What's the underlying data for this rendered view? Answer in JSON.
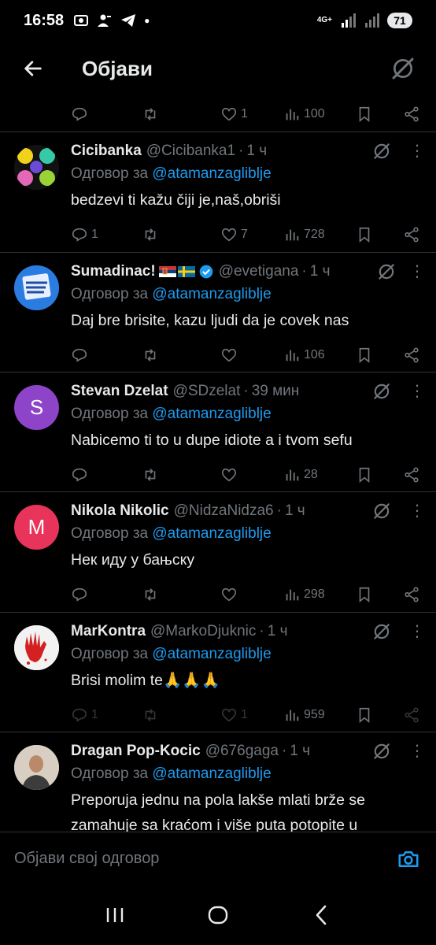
{
  "status": {
    "time": "16:58",
    "network": "4G+",
    "battery": "71"
  },
  "header": {
    "title": "Објави"
  },
  "top_actions": {
    "reply": "",
    "retweet": "",
    "like": "1",
    "views": "100"
  },
  "reply_to_label": "Одговор за",
  "tweets": [
    {
      "name": "Cicibanka",
      "handle": "@Cicibanka1",
      "time": "1 ч",
      "reply_to": "@atamanzagliblje",
      "text": "bedzevi ti kažu čiji je,naš,obriši",
      "reply": "1",
      "retweet": "",
      "like": "7",
      "views": "728"
    },
    {
      "name": "Sumadinac!",
      "handle": "@evetigana",
      "time": "1 ч",
      "reply_to": "@atamanzagliblje",
      "text": "Daj bre brisite, kazu ljudi da je covek nas",
      "reply": "",
      "retweet": "",
      "like": "",
      "views": "106",
      "avatar_text": "NAČKE SU VAM KRVAVE"
    },
    {
      "name": "Stevan Dzelat",
      "handle": "@SDzelat",
      "time": "39 мин",
      "reply_to": "@atamanzagliblje",
      "text": "Nabicemo ti to u dupe idiote a i tvom sefu",
      "reply": "",
      "retweet": "",
      "like": "",
      "views": "28",
      "avatar_letter": "S",
      "avatar_color": "#8e44c9"
    },
    {
      "name": "Nikola Nikolic",
      "handle": "@NidzaNidza6",
      "time": "1 ч",
      "reply_to": "@atamanzagliblje",
      "text": "Нек иду у бањску",
      "reply": "",
      "retweet": "",
      "like": "",
      "views": "298",
      "avatar_letter": "M",
      "avatar_color": "#e8335a"
    },
    {
      "name": "MarKontra",
      "handle": "@MarkoDjuknic",
      "time": "1 ч",
      "reply_to": "@atamanzagliblje",
      "text": "Brisi molim te🙏🙏🙏",
      "reply": "1",
      "retweet": "",
      "like": "1",
      "views": "959"
    },
    {
      "name": "Dragan Pop-Kocic",
      "handle": "@676gaga",
      "time": "1 ч",
      "reply_to": "@atamanzagliblje",
      "text": "Preporuja jednu na pola lakše mlati brže se zamahuje sa kraćom i više puta potopite u"
    }
  ],
  "composer": {
    "placeholder": "Објави свој одговор"
  },
  "colors": {
    "accent": "#1d9bf0",
    "muted": "#71767b",
    "text": "#e7e9ea",
    "divider": "#2f3336"
  }
}
